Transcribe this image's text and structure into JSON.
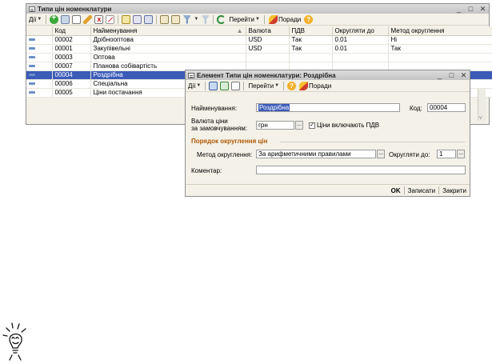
{
  "main_window": {
    "title": "Типи цін номенклатури",
    "toolbar": {
      "actions_label": "Дії",
      "goto_label": "Перейти",
      "tips_label": "Поради"
    },
    "columns": [
      "",
      "Код",
      "Найменування",
      "Валюта",
      "ПДВ",
      "Округляти до",
      "Метод округлення"
    ],
    "rows": [
      {
        "code": "00002",
        "name": "Дрібнооптова",
        "currency": "USD",
        "vat": "Так",
        "round_to": "0.01",
        "method": "Ні"
      },
      {
        "code": "00001",
        "name": "Закупівельні",
        "currency": "USD",
        "vat": "Так",
        "round_to": "0.01",
        "method": "Так"
      },
      {
        "code": "00003",
        "name": "Оптова",
        "currency": "",
        "vat": "",
        "round_to": "",
        "method": ""
      },
      {
        "code": "00007",
        "name": "Планова собівартість",
        "currency": "",
        "vat": "",
        "round_to": "",
        "method": ""
      },
      {
        "code": "00004",
        "name": "Роздрібна",
        "currency": "",
        "vat": "",
        "round_to": "",
        "method": ""
      },
      {
        "code": "00006",
        "name": "Спеціальна",
        "currency": "",
        "vat": "",
        "round_to": "",
        "method": ""
      },
      {
        "code": "00005",
        "name": "Ціни постачання",
        "currency": "",
        "vat": "",
        "round_to": "",
        "method": ""
      }
    ],
    "selected_row": 4
  },
  "dialog": {
    "title": "Елемент Типи цін номенклатури: Роздрібна",
    "toolbar": {
      "actions_label": "Дії",
      "goto_label": "Перейти",
      "tips_label": "Поради"
    },
    "name_label": "Найменування:",
    "name_value": "Роздрібна",
    "code_label": "Код:",
    "code_value": "00004",
    "currency_label_line1": "Валюта ціни",
    "currency_label_line2": "за замовчуванням:",
    "currency_value": "грн",
    "vat_checkbox_label": "Ціни включають ПДВ",
    "vat_checked": true,
    "section_title": "Порядок округлення цін",
    "method_label": "Метод округлення:",
    "method_value": "За арифметичними правилами",
    "round_label": "Округляти до:",
    "round_value": "1",
    "comment_label": "Коментар:",
    "comment_value": "",
    "ok_label": "OK",
    "save_label": "Записати",
    "close_label": "Закрити"
  },
  "colors": {
    "selection": "#3b5bb8",
    "section_title": "#b05a06",
    "window_bg": "#f3f1e8"
  }
}
